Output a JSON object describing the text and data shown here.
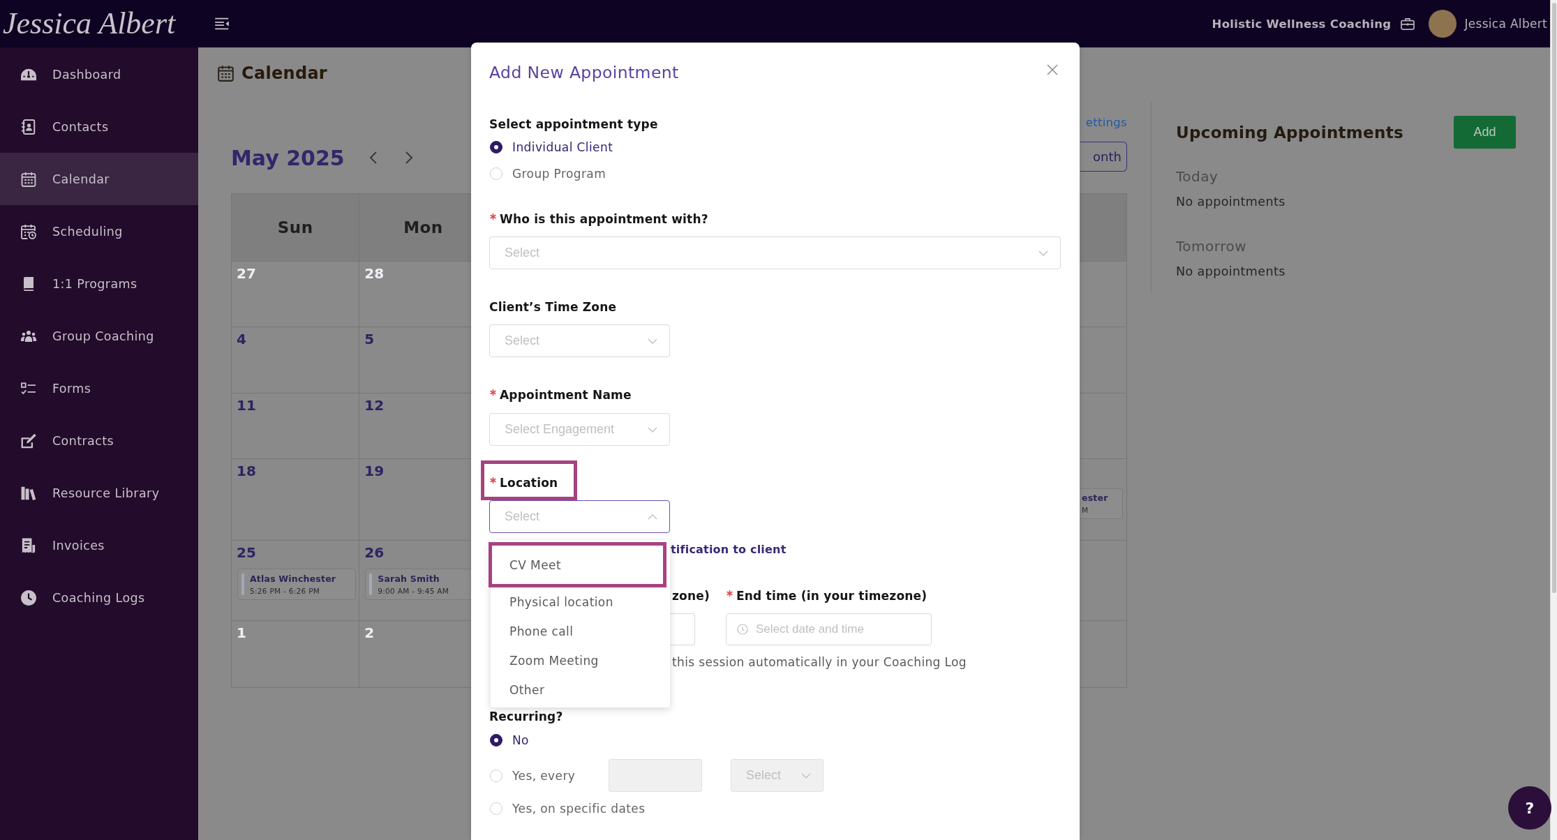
{
  "header": {
    "logo": "Jessica Albert",
    "business": "Holistic Wellness Coaching",
    "user": "Jessica Albert"
  },
  "sidebar": {
    "items": [
      {
        "label": "Dashboard",
        "selected": false
      },
      {
        "label": "Contacts",
        "selected": false
      },
      {
        "label": "Calendar",
        "selected": true
      },
      {
        "label": "Scheduling",
        "selected": false
      },
      {
        "label": "1:1 Programs",
        "selected": false
      },
      {
        "label": "Group Coaching",
        "selected": false
      },
      {
        "label": "Forms",
        "selected": false
      },
      {
        "label": "Contracts",
        "selected": false
      },
      {
        "label": "Resource Library",
        "selected": false
      },
      {
        "label": "Invoices",
        "selected": false
      },
      {
        "label": "Coaching Logs",
        "selected": false
      }
    ]
  },
  "calendar": {
    "title": "Calendar",
    "month": "May 2025",
    "settings_link": "ettings",
    "view_button": "onth",
    "weekdays": [
      "Sun",
      "Mon"
    ],
    "weeks": [
      {
        "days": [
          {
            "day": "27",
            "outside": true
          },
          {
            "day": "28",
            "outside": true
          }
        ]
      },
      {
        "days": [
          {
            "day": "4",
            "outside": false
          },
          {
            "day": "5",
            "outside": false
          }
        ]
      },
      {
        "days": [
          {
            "day": "11",
            "outside": false
          },
          {
            "day": "12",
            "outside": false
          }
        ]
      },
      {
        "days": [
          {
            "day": "18",
            "outside": false
          },
          {
            "day": "19",
            "outside": false
          }
        ],
        "edge_event": {
          "name": "ester",
          "time": "M"
        }
      },
      {
        "days": [
          {
            "day": "25",
            "outside": false,
            "events": [
              {
                "name": "Atlas Winchester",
                "time": "5:26 PM - 6:26 PM"
              }
            ]
          },
          {
            "day": "26",
            "outside": false,
            "events": [
              {
                "name": "Sarah Smith",
                "time": "9:00 AM - 9:45 AM"
              }
            ]
          }
        ]
      },
      {
        "days": [
          {
            "day": "1",
            "outside": true
          },
          {
            "day": "2",
            "outside": true
          }
        ]
      }
    ]
  },
  "upcoming": {
    "title": "Upcoming Appointments",
    "add_button": "Add",
    "groups": [
      {
        "heading": "Today",
        "text": "No appointments"
      },
      {
        "heading": "Tomorrow",
        "text": "No appointments"
      }
    ]
  },
  "modal": {
    "title": "Add New Appointment",
    "appointment_type": {
      "label": "Select appointment type",
      "options": [
        {
          "label": "Individual Client",
          "selected": true
        },
        {
          "label": "Group Program",
          "selected": false
        }
      ]
    },
    "fields": [
      {
        "label": "Who is this appointment with?",
        "required": true,
        "placeholder": "Select",
        "expanded": false,
        "highlighted": false
      },
      {
        "label": "Client’s Time Zone",
        "required": false,
        "placeholder": "Select",
        "expanded": false,
        "highlighted": false
      },
      {
        "label": "Appointment Name",
        "required": true,
        "placeholder": "Select Engagement",
        "expanded": false,
        "highlighted": false
      },
      {
        "label": "Location",
        "required": true,
        "placeholder": "Select",
        "expanded": true,
        "highlighted": true
      }
    ],
    "notification_link": "tification to client",
    "time_row": {
      "start_label": "zone)",
      "end_label": "End time (in your timezone)",
      "end_required": true,
      "end_placeholder": "Select date and time"
    },
    "log_text": "this session automatically in your Coaching Log",
    "recurring": {
      "label": "Recurring?",
      "options": [
        {
          "label": "No",
          "selected": true
        },
        {
          "label": "Yes, every",
          "selected": false,
          "count_field": {
            "disabled": true
          },
          "unit_field": {
            "placeholder": "Select",
            "disabled": true
          }
        },
        {
          "label": "Yes, on specific dates",
          "selected": false
        }
      ]
    },
    "location_menu": {
      "options": [
        {
          "label": "CV Meet",
          "highlighted": true
        },
        {
          "label": "Physical location",
          "highlighted": false
        },
        {
          "label": "Phone call",
          "highlighted": false
        },
        {
          "label": "Zoom Meeting",
          "highlighted": false
        },
        {
          "label": "Other",
          "highlighted": false
        }
      ]
    }
  },
  "help_button": "?"
}
